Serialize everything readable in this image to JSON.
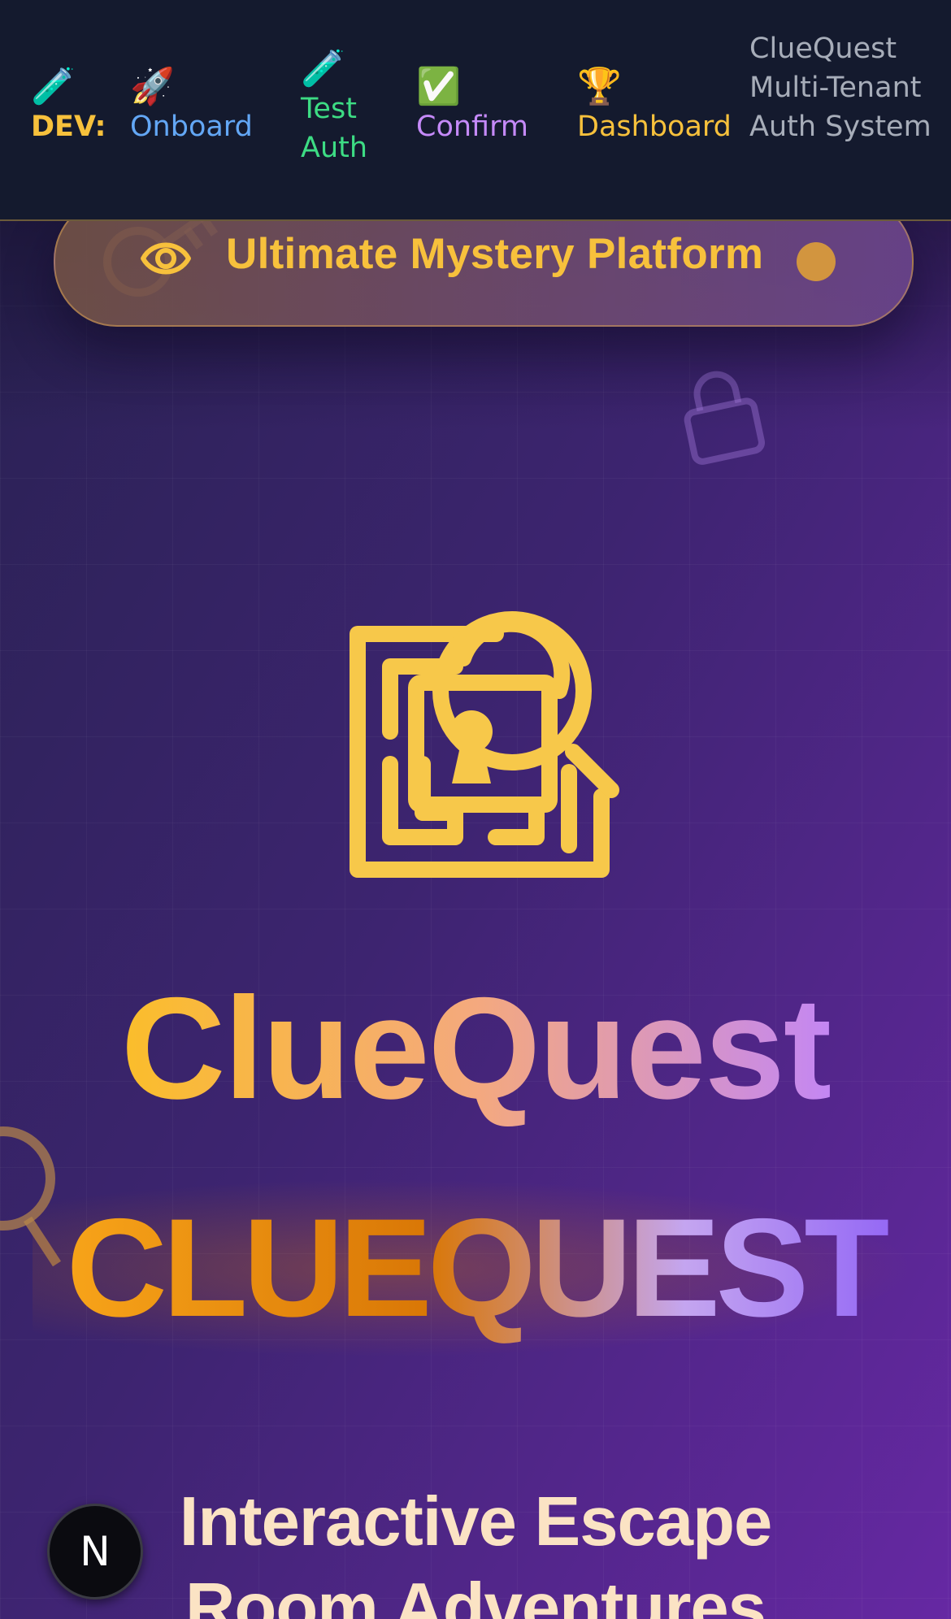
{
  "devbar": {
    "dev_emoji": "🧪",
    "dev_label": "DEV:",
    "links": [
      {
        "emoji": "🚀",
        "label": "Onboard",
        "color": "#63a7f5"
      },
      {
        "emoji": "🧪",
        "label": "Test Auth",
        "color": "#3ddc84"
      },
      {
        "emoji": "✅",
        "label": "Confirm",
        "color": "#c58af9"
      },
      {
        "emoji": "🏆",
        "label": "Dashboard",
        "color": "#f7c13c"
      }
    ],
    "title": "ClueQuest Multi-Tenant Auth System"
  },
  "hero": {
    "badge_text": "Ultimate Mystery Platform",
    "badge_icon": "eye-icon",
    "logo_icon": "maze-lock-magnifier-icon",
    "brand_title": "ClueQuest",
    "brand_title_upper": "CLUEQUEST",
    "tagline_line1": "Interactive Escape",
    "tagline_line2": "Room Adventures"
  },
  "next_badge": {
    "letter": "N"
  },
  "colors": {
    "accent": "#f7c13c",
    "nav_bg": "#141a2e",
    "hero_start": "#2a2254",
    "hero_end": "#6628a3",
    "tagline": "#fbe3c4"
  }
}
